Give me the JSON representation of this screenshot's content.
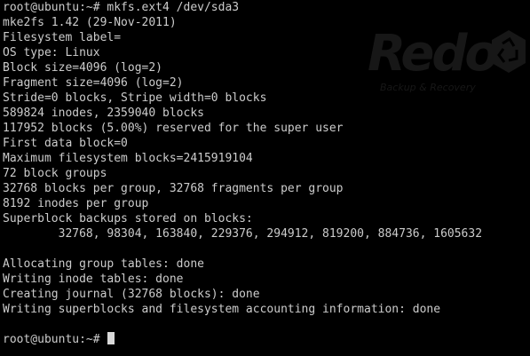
{
  "terminal": {
    "lines": [
      "root@ubuntu:~# mkfs.ext4 /dev/sda3",
      "mke2fs 1.42 (29-Nov-2011)",
      "Filesystem label=",
      "OS type: Linux",
      "Block size=4096 (log=2)",
      "Fragment size=4096 (log=2)",
      "Stride=0 blocks, Stripe width=0 blocks",
      "589824 inodes, 2359040 blocks",
      "117952 blocks (5.00%) reserved for the super user",
      "First data block=0",
      "Maximum filesystem blocks=2415919104",
      "72 block groups",
      "32768 blocks per group, 32768 fragments per group",
      "8192 inodes per group",
      "Superblock backups stored on blocks:",
      "        32768, 98304, 163840, 229376, 294912, 819200, 884736, 1605632",
      "",
      "Allocating group tables: done",
      "Writing inode tables: done",
      "Creating journal (32768 blocks): done",
      "Writing superblocks and filesystem accounting information: done",
      ""
    ],
    "prompt": "root@ubuntu:~# ",
    "colors": {
      "background": "#000000",
      "foreground": "#cccccc",
      "cursor": "#d8d8d8",
      "watermark": "#2a2a2a"
    }
  },
  "watermark": {
    "wordmark": "Redo",
    "tagline": "Backup & Recovery",
    "icon": "recycle-icon"
  }
}
